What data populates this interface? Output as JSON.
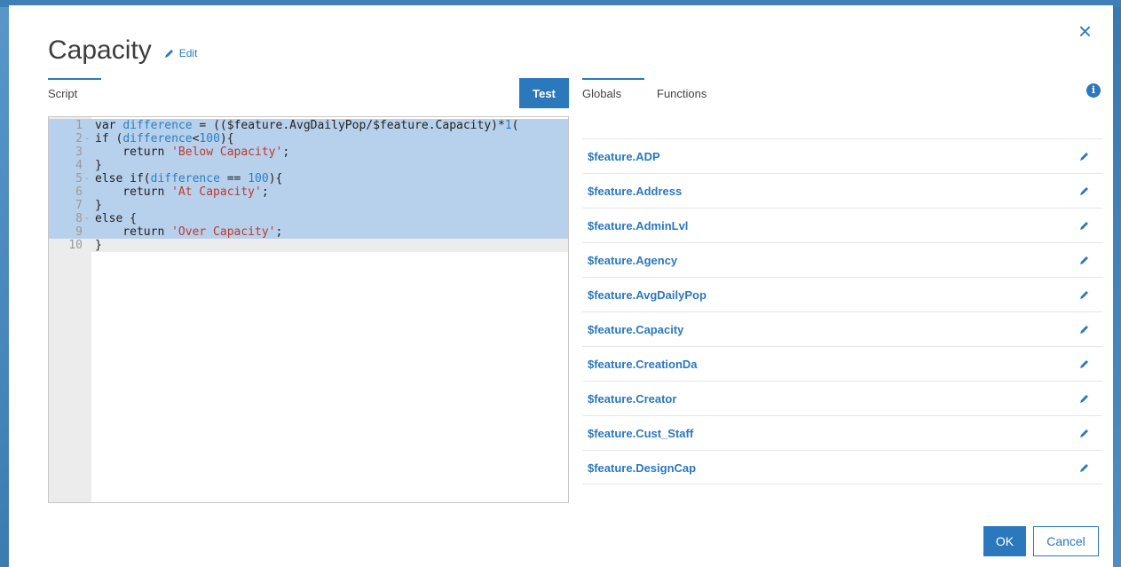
{
  "dialog": {
    "title": "Capacity",
    "edit_label": "Edit",
    "close_icon": "close-icon"
  },
  "script_panel": {
    "tab_label": "Script",
    "test_label": "Test"
  },
  "editor": {
    "lines": [
      {
        "n": "1",
        "fold": "",
        "code": "var difference = (($feature.AvgDailyPop/$feature.Capacity)*1("
      },
      {
        "n": "2",
        "fold": "-",
        "code": "if (difference<100){"
      },
      {
        "n": "3",
        "fold": "",
        "code": "    return 'Below Capacity';"
      },
      {
        "n": "4",
        "fold": "",
        "code": "}"
      },
      {
        "n": "5",
        "fold": "-",
        "code": "else if(difference == 100){"
      },
      {
        "n": "6",
        "fold": "",
        "code": "    return 'At Capacity';"
      },
      {
        "n": "7",
        "fold": "",
        "code": "}"
      },
      {
        "n": "8",
        "fold": "-",
        "code": "else {"
      },
      {
        "n": "9",
        "fold": "",
        "code": "    return 'Over Capacity';"
      },
      {
        "n": "10",
        "fold": "",
        "code": "}"
      }
    ],
    "selected_lines": 9,
    "active_line": 10
  },
  "right_panel": {
    "tabs": [
      "Globals",
      "Functions"
    ],
    "info_icon": "info-icon",
    "globals": [
      "$feature.ADP",
      "$feature.Address",
      "$feature.AdminLvl",
      "$feature.Agency",
      "$feature.AvgDailyPop",
      "$feature.Capacity",
      "$feature.CreationDa",
      "$feature.Creator",
      "$feature.Cust_Staff",
      "$feature.DesignCap"
    ]
  },
  "footer": {
    "ok_label": "OK",
    "cancel_label": "Cancel"
  },
  "colors": {
    "accent": "#2b78bd",
    "selection": "#b7d0ec",
    "string": "#c0392b"
  }
}
